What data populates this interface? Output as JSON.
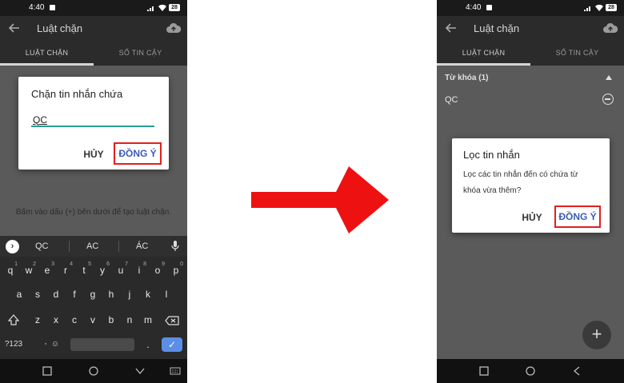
{
  "left_phone": {
    "status": {
      "time": "4:40",
      "battery": "28"
    },
    "appbar": {
      "title": "Luật chặn"
    },
    "tabs": [
      "LUẬT CHẶN",
      "SỐ TIN CẬY"
    ],
    "dialog": {
      "title": "Chặn tin nhắn chứa",
      "input_value": "QC",
      "cancel_label": "HỦY",
      "ok_label": "ĐỒNG Ý"
    },
    "hint": "Bấm vào dấu (+) bên dưới để tạo luật chặn.",
    "keyboard": {
      "suggestions": [
        "QC",
        "AC",
        "ÁC"
      ],
      "row1": [
        "q",
        "w",
        "e",
        "r",
        "t",
        "y",
        "u",
        "i",
        "o",
        "p"
      ],
      "row1_hints": [
        "1",
        "2",
        "3",
        "4",
        "5",
        "6",
        "7",
        "8",
        "9",
        "0"
      ],
      "row2": [
        "a",
        "s",
        "d",
        "f",
        "g",
        "h",
        "j",
        "k",
        "l"
      ],
      "row3": [
        "z",
        "x",
        "c",
        "v",
        "b",
        "n",
        "m"
      ],
      "symbols_label": "?123",
      "comma": ",",
      "period": "."
    }
  },
  "right_phone": {
    "status": {
      "time": "4:40",
      "battery": "28"
    },
    "appbar": {
      "title": "Luật chặn"
    },
    "tabs": [
      "LUẬT CHẶN",
      "SỐ TIN CẬY"
    ],
    "keyword_header": "Từ khóa (1)",
    "keyword_item": "QC",
    "dialog": {
      "title": "Lọc tin nhắn",
      "message_line1": "Lọc các tin nhắn đến có chứa từ",
      "message_line2": "khóa vừa thêm?",
      "cancel_label": "HỦY",
      "ok_label": "ĐỒNG Ý"
    }
  },
  "colors": {
    "arrow": "#ee1111",
    "highlight": "#e02020",
    "accent_blue": "#3b5bb5",
    "input_underline": "#2a9d8f"
  },
  "icons": [
    "back-arrow-icon",
    "cloud-upload-icon",
    "wifi-icon",
    "signal-icon",
    "battery-icon",
    "mic-icon",
    "emoji-icon",
    "shift-icon",
    "backspace-icon",
    "check-icon",
    "home-icon",
    "back-icon",
    "recents-icon",
    "plus-icon",
    "remove-icon",
    "chevron-up-icon",
    "right-arrow-icon"
  ]
}
